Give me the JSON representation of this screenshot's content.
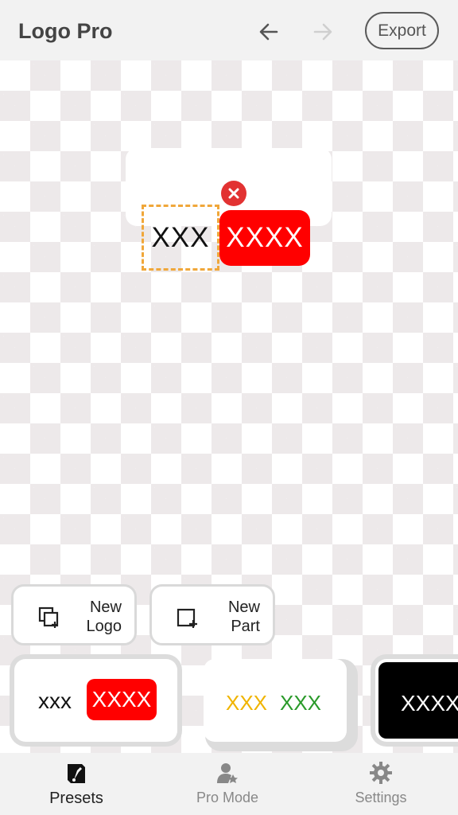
{
  "header": {
    "title": "Logo Pro",
    "undo_icon": "arrow-left-icon",
    "redo_icon": "arrow-right-icon",
    "export_label": "Export"
  },
  "canvas": {
    "logo": {
      "text_part": "XXX",
      "badge_part": "XXXX",
      "badge_color": "#ff0000",
      "selection_color": "#f0a73a"
    },
    "delete_icon": "close-icon"
  },
  "actions": {
    "new_logo": {
      "line1": "New",
      "line2": "Logo",
      "icon": "new-logo-icon"
    },
    "new_part": {
      "line1": "New",
      "line2": "Part",
      "icon": "new-part-icon"
    }
  },
  "presets": [
    {
      "text_a": "xxx",
      "text_b": "XXXX",
      "color_a": "#111111",
      "badge_color": "#ff0000"
    },
    {
      "text_a": "XXX",
      "text_b": "XXX",
      "color_a": "#f0b400",
      "color_b": "#2a9a2a"
    },
    {
      "text_a": "XXXX",
      "background": "#000000"
    }
  ],
  "nav": {
    "items": [
      {
        "label": "Presets",
        "icon": "presets-icon",
        "active": true
      },
      {
        "label": "Pro Mode",
        "icon": "pro-mode-icon",
        "active": false
      },
      {
        "label": "Settings",
        "icon": "settings-gear-icon",
        "active": false
      }
    ]
  }
}
